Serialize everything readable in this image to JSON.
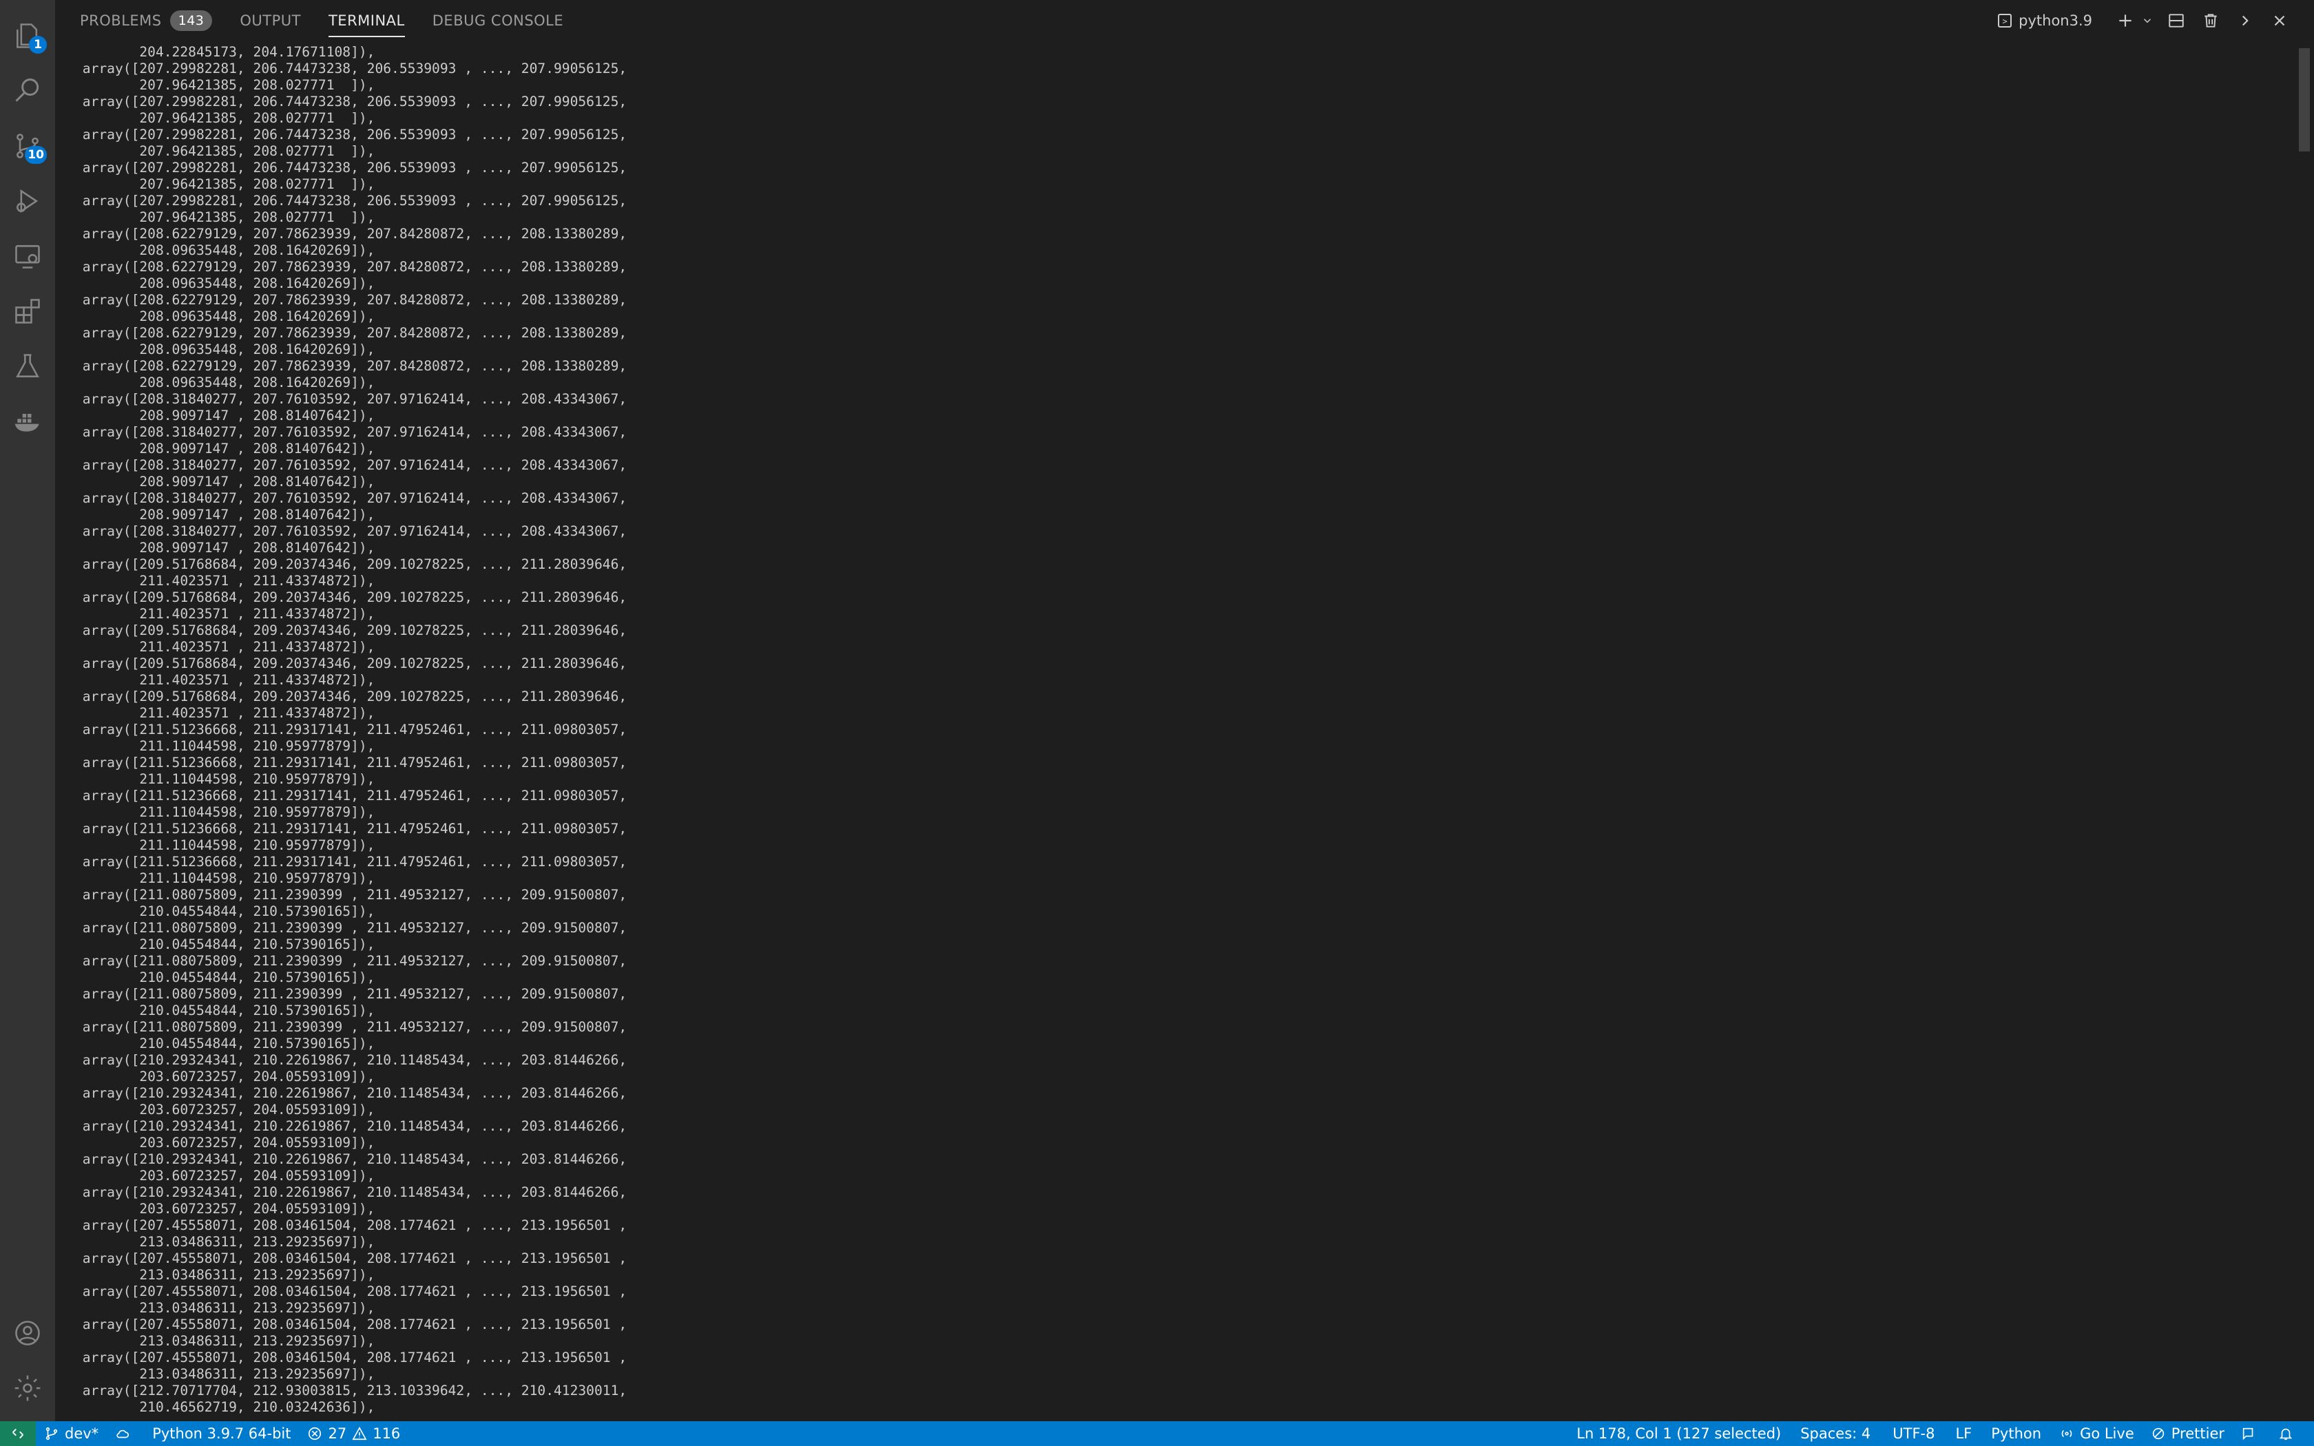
{
  "panel": {
    "tabs": [
      {
        "label": "PROBLEMS",
        "badge": "143"
      },
      {
        "label": "OUTPUT"
      },
      {
        "label": "TERMINAL"
      },
      {
        "label": "DEBUG CONSOLE"
      }
    ],
    "active_tab": "TERMINAL",
    "terminal_name": "python3.9"
  },
  "activity_bar": {
    "explorer_badge": "1",
    "source_control_badge": "10"
  },
  "terminal": {
    "lines": [
      "        204.22845173, 204.17671108]),",
      " array([207.29982281, 206.74473238, 206.5539093 , ..., 207.99056125,",
      "        207.96421385, 208.027771  ]),",
      " array([207.29982281, 206.74473238, 206.5539093 , ..., 207.99056125,",
      "        207.96421385, 208.027771  ]),",
      " array([207.29982281, 206.74473238, 206.5539093 , ..., 207.99056125,",
      "        207.96421385, 208.027771  ]),",
      " array([207.29982281, 206.74473238, 206.5539093 , ..., 207.99056125,",
      "        207.96421385, 208.027771  ]),",
      " array([207.29982281, 206.74473238, 206.5539093 , ..., 207.99056125,",
      "        207.96421385, 208.027771  ]),",
      " array([208.62279129, 207.78623939, 207.84280872, ..., 208.13380289,",
      "        208.09635448, 208.16420269]),",
      " array([208.62279129, 207.78623939, 207.84280872, ..., 208.13380289,",
      "        208.09635448, 208.16420269]),",
      " array([208.62279129, 207.78623939, 207.84280872, ..., 208.13380289,",
      "        208.09635448, 208.16420269]),",
      " array([208.62279129, 207.78623939, 207.84280872, ..., 208.13380289,",
      "        208.09635448, 208.16420269]),",
      " array([208.62279129, 207.78623939, 207.84280872, ..., 208.13380289,",
      "        208.09635448, 208.16420269]),",
      " array([208.31840277, 207.76103592, 207.97162414, ..., 208.43343067,",
      "        208.9097147 , 208.81407642]),",
      " array([208.31840277, 207.76103592, 207.97162414, ..., 208.43343067,",
      "        208.9097147 , 208.81407642]),",
      " array([208.31840277, 207.76103592, 207.97162414, ..., 208.43343067,",
      "        208.9097147 , 208.81407642]),",
      " array([208.31840277, 207.76103592, 207.97162414, ..., 208.43343067,",
      "        208.9097147 , 208.81407642]),",
      " array([208.31840277, 207.76103592, 207.97162414, ..., 208.43343067,",
      "        208.9097147 , 208.81407642]),",
      " array([209.51768684, 209.20374346, 209.10278225, ..., 211.28039646,",
      "        211.4023571 , 211.43374872]),",
      " array([209.51768684, 209.20374346, 209.10278225, ..., 211.28039646,",
      "        211.4023571 , 211.43374872]),",
      " array([209.51768684, 209.20374346, 209.10278225, ..., 211.28039646,",
      "        211.4023571 , 211.43374872]),",
      " array([209.51768684, 209.20374346, 209.10278225, ..., 211.28039646,",
      "        211.4023571 , 211.43374872]),",
      " array([209.51768684, 209.20374346, 209.10278225, ..., 211.28039646,",
      "        211.4023571 , 211.43374872]),",
      " array([211.51236668, 211.29317141, 211.47952461, ..., 211.09803057,",
      "        211.11044598, 210.95977879]),",
      " array([211.51236668, 211.29317141, 211.47952461, ..., 211.09803057,",
      "        211.11044598, 210.95977879]),",
      " array([211.51236668, 211.29317141, 211.47952461, ..., 211.09803057,",
      "        211.11044598, 210.95977879]),",
      " array([211.51236668, 211.29317141, 211.47952461, ..., 211.09803057,",
      "        211.11044598, 210.95977879]),",
      " array([211.51236668, 211.29317141, 211.47952461, ..., 211.09803057,",
      "        211.11044598, 210.95977879]),",
      " array([211.08075809, 211.2390399 , 211.49532127, ..., 209.91500807,",
      "        210.04554844, 210.57390165]),",
      " array([211.08075809, 211.2390399 , 211.49532127, ..., 209.91500807,",
      "        210.04554844, 210.57390165]),",
      " array([211.08075809, 211.2390399 , 211.49532127, ..., 209.91500807,",
      "        210.04554844, 210.57390165]),",
      " array([211.08075809, 211.2390399 , 211.49532127, ..., 209.91500807,",
      "        210.04554844, 210.57390165]),",
      " array([211.08075809, 211.2390399 , 211.49532127, ..., 209.91500807,",
      "        210.04554844, 210.57390165]),",
      " array([210.29324341, 210.22619867, 210.11485434, ..., 203.81446266,",
      "        203.60723257, 204.05593109]),",
      " array([210.29324341, 210.22619867, 210.11485434, ..., 203.81446266,",
      "        203.60723257, 204.05593109]),",
      " array([210.29324341, 210.22619867, 210.11485434, ..., 203.81446266,",
      "        203.60723257, 204.05593109]),",
      " array([210.29324341, 210.22619867, 210.11485434, ..., 203.81446266,",
      "        203.60723257, 204.05593109]),",
      " array([210.29324341, 210.22619867, 210.11485434, ..., 203.81446266,",
      "        203.60723257, 204.05593109]),",
      " array([207.45558071, 208.03461504, 208.1774621 , ..., 213.1956501 ,",
      "        213.03486311, 213.29235697]),",
      " array([207.45558071, 208.03461504, 208.1774621 , ..., 213.1956501 ,",
      "        213.03486311, 213.29235697]),",
      " array([207.45558071, 208.03461504, 208.1774621 , ..., 213.1956501 ,",
      "        213.03486311, 213.29235697]),",
      " array([207.45558071, 208.03461504, 208.1774621 , ..., 213.1956501 ,",
      "        213.03486311, 213.29235697]),",
      " array([207.45558071, 208.03461504, 208.1774621 , ..., 213.1956501 ,",
      "        213.03486311, 213.29235697]),",
      " array([212.70717704, 212.93003815, 213.10339642, ..., 210.41230011,",
      "        210.46562719, 210.03242636]),"
    ]
  },
  "status_bar": {
    "branch": "dev*",
    "interpreter": "Python 3.9.7 64-bit",
    "errors": "27",
    "warnings": "116",
    "cursor": "Ln 178, Col 1 (127 selected)",
    "indent": "Spaces: 4",
    "encoding": "UTF-8",
    "eol": "LF",
    "language": "Python",
    "go_live": "Go Live",
    "prettier": "Prettier"
  },
  "colors": {
    "status_bar": "#007acc",
    "remote": "#16825d",
    "badge": "#0078d4",
    "activity_bar": "#333333",
    "background": "#1e1e1e"
  }
}
